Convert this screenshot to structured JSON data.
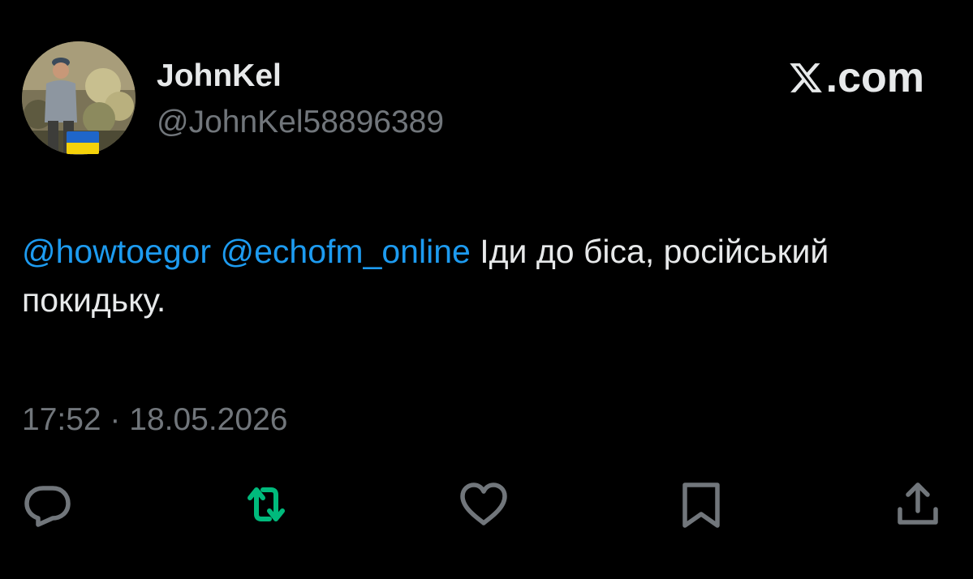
{
  "author": {
    "display_name": "JohnKel",
    "handle": "@JohnKel58896389",
    "flag": "ukraine-flag"
  },
  "site": {
    "label": ".com",
    "logo_icon": "x-logo-icon"
  },
  "tweet": {
    "mentions": [
      "@howtoegor",
      "@echofm_online"
    ],
    "text": "Іди до біса, російський покидьку.",
    "timestamp": "17:52 · 18.05.2026"
  },
  "actions": [
    {
      "name": "reply",
      "icon": "reply-icon"
    },
    {
      "name": "retweet",
      "icon": "retweet-icon",
      "active": true
    },
    {
      "name": "like",
      "icon": "heart-icon"
    },
    {
      "name": "bookmark",
      "icon": "bookmark-icon"
    },
    {
      "name": "share",
      "icon": "share-icon"
    }
  ],
  "colors": {
    "background": "#000000",
    "text": "#e7e9ea",
    "secondary": "#71767b",
    "mention": "#1d9bf0",
    "retweet_active": "#00ba7c"
  }
}
